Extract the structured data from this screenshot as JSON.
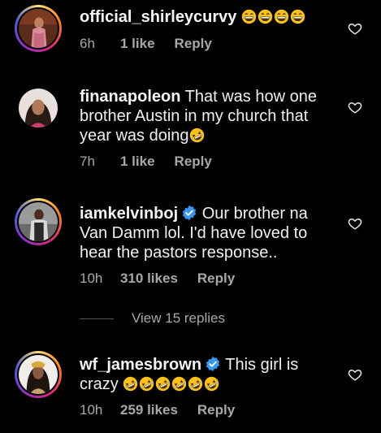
{
  "comments": [
    {
      "username": "official_shirleycurvy",
      "text": "",
      "emojis": [
        "grin-sweat",
        "grin-sweat",
        "grin-sweat",
        "grin-sweat"
      ],
      "time": "6h",
      "likes": "1 like",
      "reply": "Reply",
      "verified": false
    },
    {
      "username": "finanapoleon",
      "text": "That was how one brother Austin in my church that year was doing",
      "emojis": [
        "rofl"
      ],
      "time": "7h",
      "likes": "1 like",
      "reply": "Reply",
      "verified": false
    },
    {
      "username": "iamkelvinboj",
      "text": "Our brother na Van Damm lol. I'd have loved to hear the pastors response..",
      "emojis": [],
      "time": "10h",
      "likes": "310 likes",
      "reply": "Reply",
      "verified": true
    },
    {
      "username": "wf_jamesbrown",
      "text": "This girl is crazy",
      "emojis": [
        "rofl",
        "rofl",
        "rofl",
        "rofl",
        "rofl",
        "rofl"
      ],
      "time": "10h",
      "likes": "259 likes",
      "reply": "Reply",
      "verified": true
    }
  ],
  "view_replies": "View 15 replies",
  "colors": {
    "background": "#000000",
    "text": "#f5f5f5",
    "muted": "#a8a8a8",
    "verified": "#3897f0"
  }
}
